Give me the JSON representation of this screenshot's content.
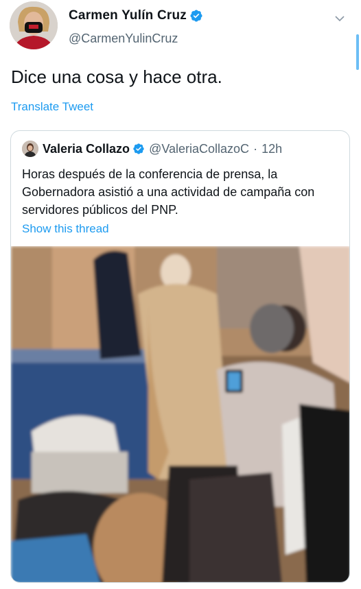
{
  "tweet": {
    "author_name": "Carmen Yulín Cruz",
    "author_handle": "@CarmenYulinCruz",
    "text": "Dice una cosa y hace otra.",
    "translate_label": "Translate Tweet"
  },
  "quoted": {
    "author_name": "Valeria Collazo",
    "author_handle": "@ValeriaCollazoC",
    "separator": "·",
    "time": "12h",
    "text": "Horas después de la conferencia de prensa, la Gobernadora asistió a una actividad de campaña con servidores públicos del PNP.",
    "show_thread_label": "Show this thread"
  },
  "colors": {
    "accent": "#1d9bf0",
    "secondary_text": "#536471",
    "border": "#cfd9de"
  },
  "icons": [
    "verified-badge-icon",
    "chevron-down-icon",
    "avatar-image",
    "video-thumbnail"
  ]
}
